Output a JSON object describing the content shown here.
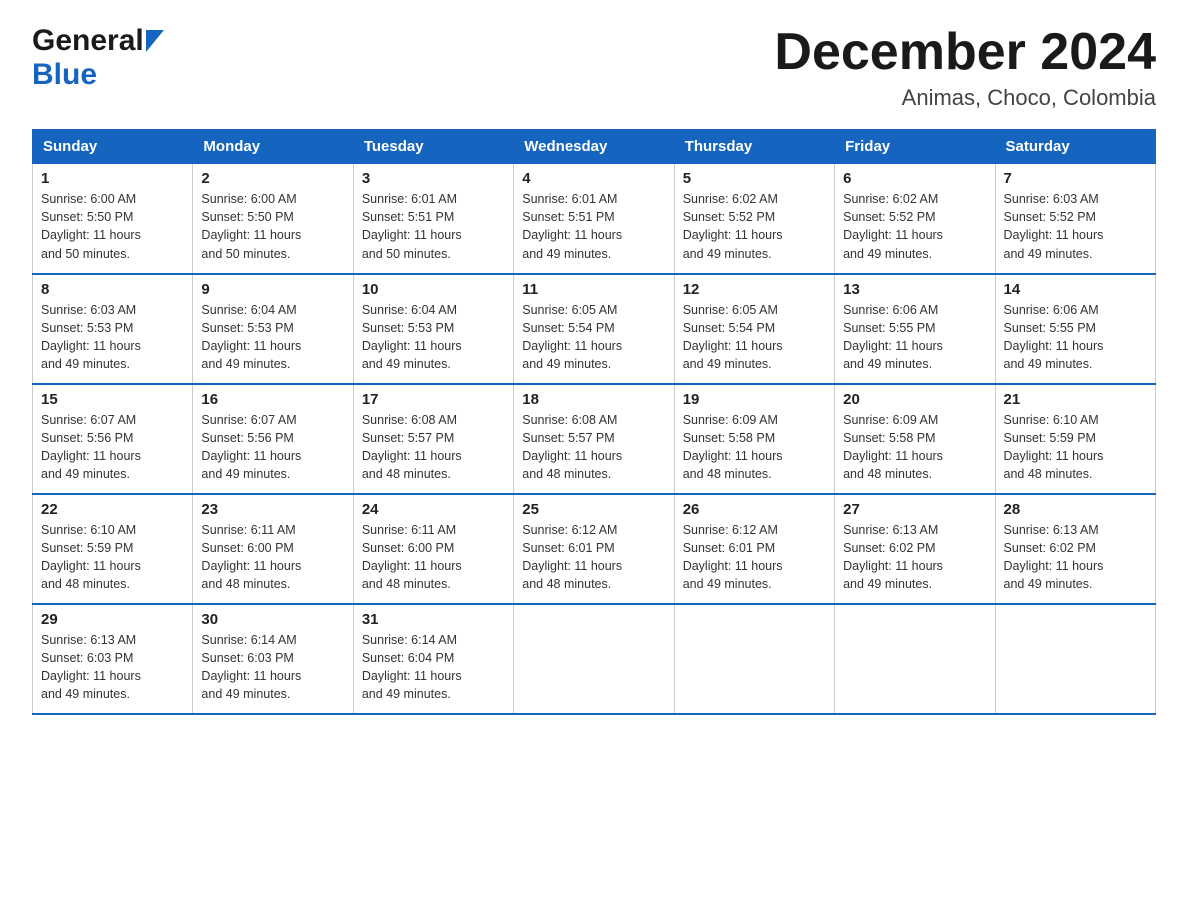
{
  "header": {
    "logo_general": "General",
    "logo_blue": "Blue",
    "title": "December 2024",
    "subtitle": "Animas, Choco, Colombia"
  },
  "calendar": {
    "days_of_week": [
      "Sunday",
      "Monday",
      "Tuesday",
      "Wednesday",
      "Thursday",
      "Friday",
      "Saturday"
    ],
    "weeks": [
      [
        {
          "day": "1",
          "sunrise": "6:00 AM",
          "sunset": "5:50 PM",
          "daylight": "11 hours and 50 minutes."
        },
        {
          "day": "2",
          "sunrise": "6:00 AM",
          "sunset": "5:50 PM",
          "daylight": "11 hours and 50 minutes."
        },
        {
          "day": "3",
          "sunrise": "6:01 AM",
          "sunset": "5:51 PM",
          "daylight": "11 hours and 50 minutes."
        },
        {
          "day": "4",
          "sunrise": "6:01 AM",
          "sunset": "5:51 PM",
          "daylight": "11 hours and 49 minutes."
        },
        {
          "day": "5",
          "sunrise": "6:02 AM",
          "sunset": "5:52 PM",
          "daylight": "11 hours and 49 minutes."
        },
        {
          "day": "6",
          "sunrise": "6:02 AM",
          "sunset": "5:52 PM",
          "daylight": "11 hours and 49 minutes."
        },
        {
          "day": "7",
          "sunrise": "6:03 AM",
          "sunset": "5:52 PM",
          "daylight": "11 hours and 49 minutes."
        }
      ],
      [
        {
          "day": "8",
          "sunrise": "6:03 AM",
          "sunset": "5:53 PM",
          "daylight": "11 hours and 49 minutes."
        },
        {
          "day": "9",
          "sunrise": "6:04 AM",
          "sunset": "5:53 PM",
          "daylight": "11 hours and 49 minutes."
        },
        {
          "day": "10",
          "sunrise": "6:04 AM",
          "sunset": "5:53 PM",
          "daylight": "11 hours and 49 minutes."
        },
        {
          "day": "11",
          "sunrise": "6:05 AM",
          "sunset": "5:54 PM",
          "daylight": "11 hours and 49 minutes."
        },
        {
          "day": "12",
          "sunrise": "6:05 AM",
          "sunset": "5:54 PM",
          "daylight": "11 hours and 49 minutes."
        },
        {
          "day": "13",
          "sunrise": "6:06 AM",
          "sunset": "5:55 PM",
          "daylight": "11 hours and 49 minutes."
        },
        {
          "day": "14",
          "sunrise": "6:06 AM",
          "sunset": "5:55 PM",
          "daylight": "11 hours and 49 minutes."
        }
      ],
      [
        {
          "day": "15",
          "sunrise": "6:07 AM",
          "sunset": "5:56 PM",
          "daylight": "11 hours and 49 minutes."
        },
        {
          "day": "16",
          "sunrise": "6:07 AM",
          "sunset": "5:56 PM",
          "daylight": "11 hours and 49 minutes."
        },
        {
          "day": "17",
          "sunrise": "6:08 AM",
          "sunset": "5:57 PM",
          "daylight": "11 hours and 48 minutes."
        },
        {
          "day": "18",
          "sunrise": "6:08 AM",
          "sunset": "5:57 PM",
          "daylight": "11 hours and 48 minutes."
        },
        {
          "day": "19",
          "sunrise": "6:09 AM",
          "sunset": "5:58 PM",
          "daylight": "11 hours and 48 minutes."
        },
        {
          "day": "20",
          "sunrise": "6:09 AM",
          "sunset": "5:58 PM",
          "daylight": "11 hours and 48 minutes."
        },
        {
          "day": "21",
          "sunrise": "6:10 AM",
          "sunset": "5:59 PM",
          "daylight": "11 hours and 48 minutes."
        }
      ],
      [
        {
          "day": "22",
          "sunrise": "6:10 AM",
          "sunset": "5:59 PM",
          "daylight": "11 hours and 48 minutes."
        },
        {
          "day": "23",
          "sunrise": "6:11 AM",
          "sunset": "6:00 PM",
          "daylight": "11 hours and 48 minutes."
        },
        {
          "day": "24",
          "sunrise": "6:11 AM",
          "sunset": "6:00 PM",
          "daylight": "11 hours and 48 minutes."
        },
        {
          "day": "25",
          "sunrise": "6:12 AM",
          "sunset": "6:01 PM",
          "daylight": "11 hours and 48 minutes."
        },
        {
          "day": "26",
          "sunrise": "6:12 AM",
          "sunset": "6:01 PM",
          "daylight": "11 hours and 49 minutes."
        },
        {
          "day": "27",
          "sunrise": "6:13 AM",
          "sunset": "6:02 PM",
          "daylight": "11 hours and 49 minutes."
        },
        {
          "day": "28",
          "sunrise": "6:13 AM",
          "sunset": "6:02 PM",
          "daylight": "11 hours and 49 minutes."
        }
      ],
      [
        {
          "day": "29",
          "sunrise": "6:13 AM",
          "sunset": "6:03 PM",
          "daylight": "11 hours and 49 minutes."
        },
        {
          "day": "30",
          "sunrise": "6:14 AM",
          "sunset": "6:03 PM",
          "daylight": "11 hours and 49 minutes."
        },
        {
          "day": "31",
          "sunrise": "6:14 AM",
          "sunset": "6:04 PM",
          "daylight": "11 hours and 49 minutes."
        },
        null,
        null,
        null,
        null
      ]
    ],
    "labels": {
      "sunrise": "Sunrise:",
      "sunset": "Sunset:",
      "daylight": "Daylight:"
    }
  }
}
